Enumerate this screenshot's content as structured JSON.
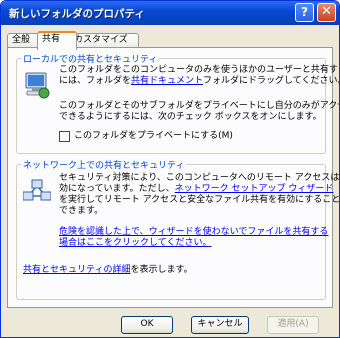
{
  "window": {
    "title": "新しいフォルダのプロパティ"
  },
  "titlebar": {
    "help": "?",
    "close": "✕"
  },
  "tabs": [
    {
      "label": "全般"
    },
    {
      "label": "共有"
    },
    {
      "label": "カスタマイズ"
    }
  ],
  "local_group": {
    "title": "ローカルでの共有とセキュリティ",
    "para1_line1": "このフォルダをこのコンピュータのみを使うほかのユーザーと共有する",
    "para1_line2_a": "には、フォルダを",
    "para1_link": "共有ドキュメント",
    "para1_line2_b": "フォルダにドラッグしてください。",
    "para2_line1": "このフォルダとそのサブフォルダをプライベートにし自分のみがアクセス",
    "para2_line2": "できるようにするには、次のチェック ボックスをオンにします。",
    "checkbox_label": "このフォルダをプライベートにする(M)"
  },
  "network_group": {
    "title": "ネットワーク上での共有とセキュリティ",
    "line1": "セキュリティ対策により、このコンピュータへのリモート アクセスは無",
    "line2_a": "効になっています。ただし、",
    "line2_link": "ネットワーク セットアップ ウィザード",
    "line3": "を実行してリモート アクセスと安全なファイル共有を有効にすることが",
    "line4": "できます。",
    "warn_line1": "危険を認識した上で、ウィザードを使わないでファイルを共有する",
    "warn_line2": "場合はここをクリックしてください。",
    "details_link": "共有とセキュリティの詳細",
    "details_text": "を表示します。"
  },
  "buttons": {
    "ok": "OK",
    "cancel": "キャンセル",
    "apply": "適用(A)"
  },
  "colors": {
    "titlebar": "#0a48d6",
    "group_title": "#0046d5",
    "link": "#0000ff",
    "dialog_bg": "#ece9d8"
  }
}
